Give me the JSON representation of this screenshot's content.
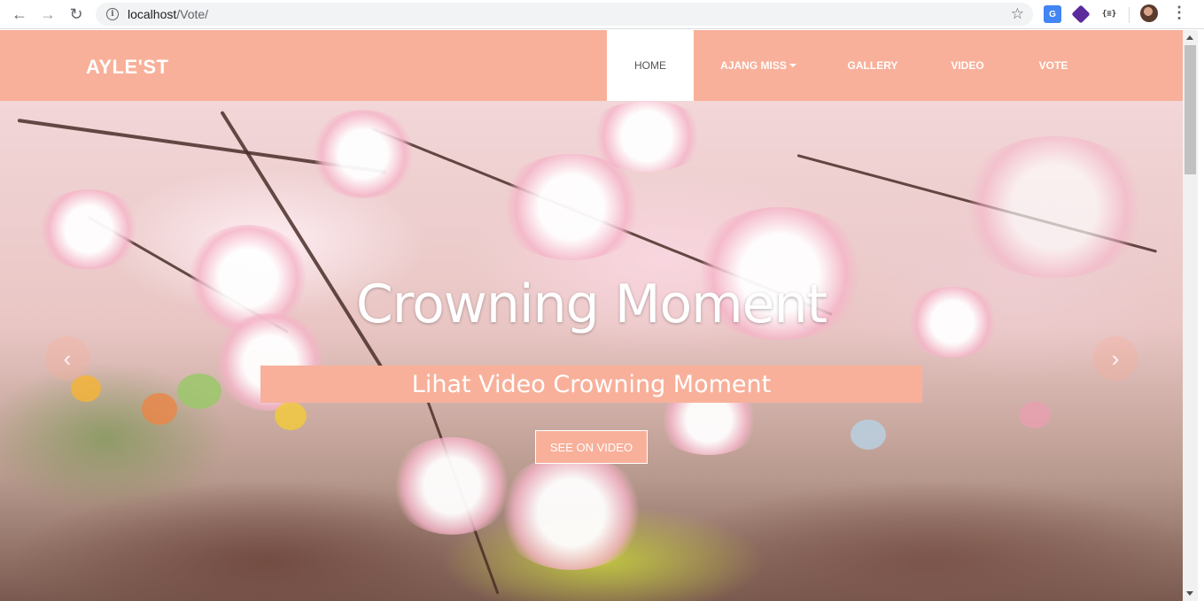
{
  "browser": {
    "url_host": "localhost",
    "url_path": "/Vote/",
    "extensions": [
      "google-translate-icon",
      "cube-extension-icon",
      "json-extension-icon"
    ],
    "json_ext_label": "{≡}"
  },
  "navbar": {
    "brand": "AYLE'ST",
    "items": [
      {
        "label": "HOME",
        "active": true
      },
      {
        "label": "AJANG MISS",
        "dropdown": true
      },
      {
        "label": "GALLERY"
      },
      {
        "label": "VIDEO"
      },
      {
        "label": "VOTE"
      }
    ]
  },
  "hero": {
    "title": "Crowning Moment",
    "subtitle": "Lihat Video Crowning Moment",
    "cta_label": "SEE ON VIDEO"
  },
  "colors": {
    "accent": "#f8b09a",
    "white": "#ffffff"
  }
}
